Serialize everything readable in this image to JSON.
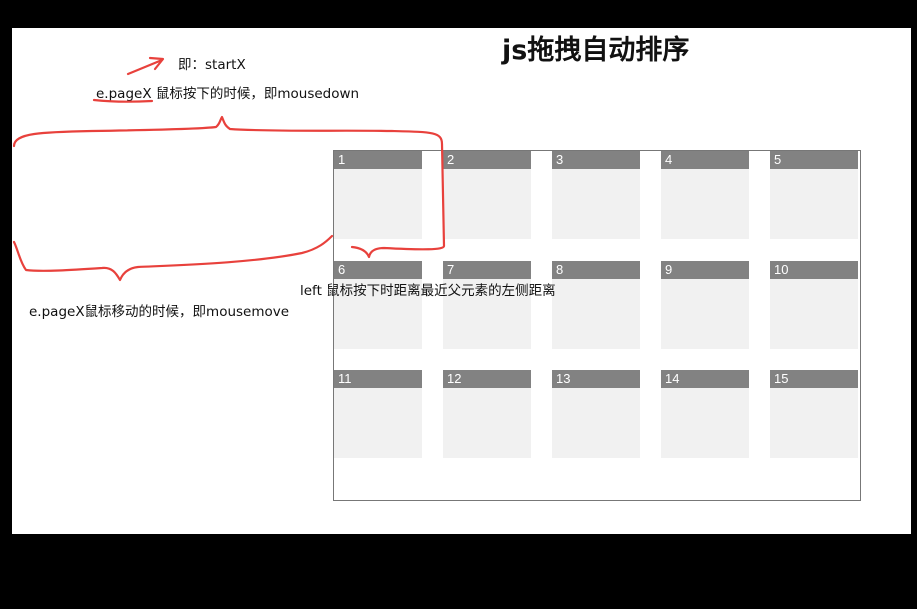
{
  "page": {
    "title": "js拖拽自动排序"
  },
  "annotations": {
    "startx": "即：startX",
    "mousedown": "e.pageX 鼠标按下的时候，即mousedown",
    "mousemove": "e.pageX鼠标移动的时候，即mousemove",
    "left": "left 鼠标按下时距离最近父元素的左侧距离"
  },
  "grid": {
    "items": [
      "1",
      "2",
      "3",
      "4",
      "5",
      "6",
      "7",
      "8",
      "9",
      "10",
      "11",
      "12",
      "13",
      "14",
      "15"
    ]
  },
  "colors": {
    "item_header": "#828282",
    "item_body": "#f1f1f1",
    "annotation_red": "#e8413c",
    "background": "#ffffff",
    "frame": "#000000"
  }
}
